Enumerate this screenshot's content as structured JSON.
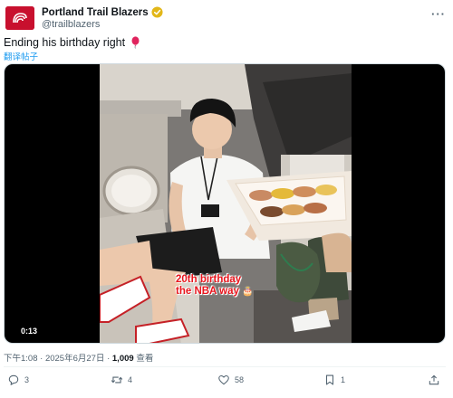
{
  "author": {
    "display_name": "Portland Trail Blazers",
    "handle": "@trailblazers"
  },
  "tweet": {
    "text": "Ending his birthday right",
    "translate_label": "翻译帖子"
  },
  "video": {
    "caption_line1": "20th birthday",
    "caption_line2": "the NBA way",
    "timecode": "0:13"
  },
  "meta": {
    "time": "下午1:08",
    "separator": "·",
    "date": "2025年6月27日",
    "views": "1,009",
    "views_label": "查看"
  },
  "actions": {
    "replies": "3",
    "retweets": "4",
    "likes": "58",
    "bookmarks": "1"
  },
  "colors": {
    "brand_red": "#c8102e",
    "link_blue": "#1d9bf0",
    "text_secondary": "#536471"
  }
}
